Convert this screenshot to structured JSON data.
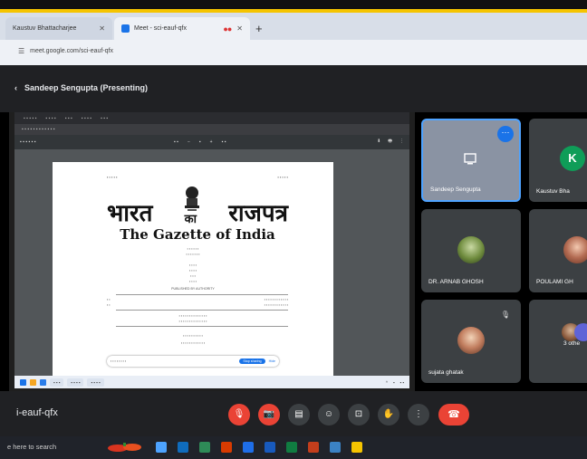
{
  "browser": {
    "tabs": [
      {
        "label": "Kaustuv Bhattacharjee",
        "active": false
      },
      {
        "label": "Meet - sci-eauf-qfx",
        "active": true
      }
    ],
    "url": "meet.google.com/sci-eauf-qfx"
  },
  "meet": {
    "presenter_label": "Sandeep Sengupta (Presenting)",
    "meeting_code": "i-eauf-qfx",
    "participants": [
      {
        "name": "Sandeep Sengupta"
      },
      {
        "name": "Kaustuv Bha",
        "initial": "K"
      },
      {
        "name": "DR. ARNAB GHOSH"
      },
      {
        "name": "POULAMI GH"
      },
      {
        "name": "sujata ghatak"
      },
      {
        "name": "3 othe"
      }
    ]
  },
  "shared_screen": {
    "gazette": {
      "hindi_left": "भारत",
      "hindi_mid": "का",
      "hindi_right": "राजपत्र",
      "english": "The Gazette of India",
      "authority": "PUBLISHED BY AUTHORITY"
    },
    "sharing_notice": {
      "stop_label": "Stop sharing",
      "hide_label": "Hide"
    }
  },
  "taskbar": {
    "search_placeholder": "e here to search"
  }
}
